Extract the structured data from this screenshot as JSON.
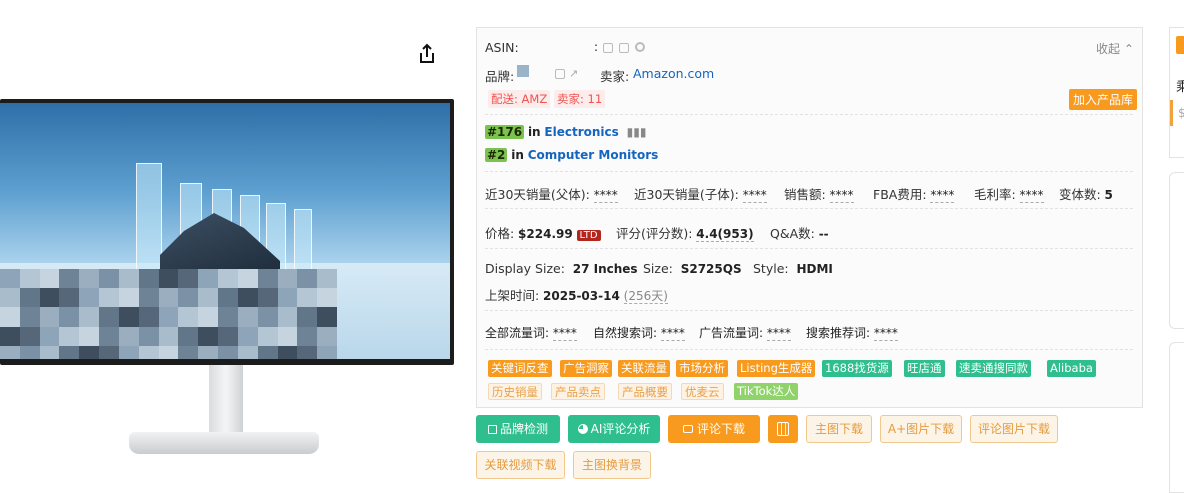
{
  "product": {
    "asin_label": "ASIN:",
    "asin_value": ":",
    "brand_label": "品牌:",
    "seller_label": "卖家:",
    "seller_value": "Amazon.com",
    "collapse_label": "收起",
    "delivery_badge": "配送: AMZ",
    "seller_count_badge": "卖家: 11",
    "add_to_library": "加入产品库"
  },
  "ranks": [
    {
      "rank": "#176",
      "in": "in",
      "category": "Electronics"
    },
    {
      "rank": "#2",
      "in": "in",
      "category": "Computer Monitors"
    }
  ],
  "metrics": [
    {
      "label": "近30天销量(父体):",
      "value": "****"
    },
    {
      "label": "近30天销量(子体):",
      "value": "****"
    },
    {
      "label": "销售额:",
      "value": "****"
    },
    {
      "label": "FBA费用:",
      "value": "****"
    },
    {
      "label": "毛利率:",
      "value": "****"
    },
    {
      "label": "变体数:",
      "value": "5"
    }
  ],
  "price": {
    "price_label": "价格:",
    "price_value": "$224.99",
    "ltd": "LTD",
    "rating_label": "评分(评分数):",
    "rating_value": "4.4(953)",
    "qa_label": "Q&A数:",
    "qa_value": "--"
  },
  "specs": [
    {
      "label": "Display Size:",
      "value": "27 Inches"
    },
    {
      "label": "Size:",
      "value": "S2725QS"
    },
    {
      "label": "Style:",
      "value": "HDMI"
    }
  ],
  "listing": {
    "label": "上架时间:",
    "date": "2025-03-14",
    "days": "(256天)"
  },
  "traffic": [
    {
      "label": "全部流量词:",
      "value": "****"
    },
    {
      "label": "自然搜索词:",
      "value": "****"
    },
    {
      "label": "广告流量词:",
      "value": "****"
    },
    {
      "label": "搜索推荐词:",
      "value": "****"
    }
  ],
  "tags_row1": [
    "关键词反查",
    "广告洞察",
    "关联流量",
    "市场分析",
    "Listing生成器",
    "1688找货源",
    "旺店通",
    "速卖通搜同款",
    "Alibaba"
  ],
  "tags_row2": [
    "历史销量",
    "产品卖点",
    "产品概要",
    "优麦云",
    "TikTok达人"
  ],
  "buttons_row1": [
    "品牌检测",
    "AI评论分析",
    "评论下载",
    "",
    "主图下载",
    "A+图片下载",
    "评论图片下载"
  ],
  "buttons_row2": [
    "关联视频下载",
    "主图换背景"
  ],
  "right_widget": {
    "char": "乘",
    "dollar": "$"
  },
  "colors": {
    "orange": "#f79a1e",
    "green": "#2fbf8f",
    "link_blue": "#1565c0",
    "rank_green": "#7cc24e"
  }
}
